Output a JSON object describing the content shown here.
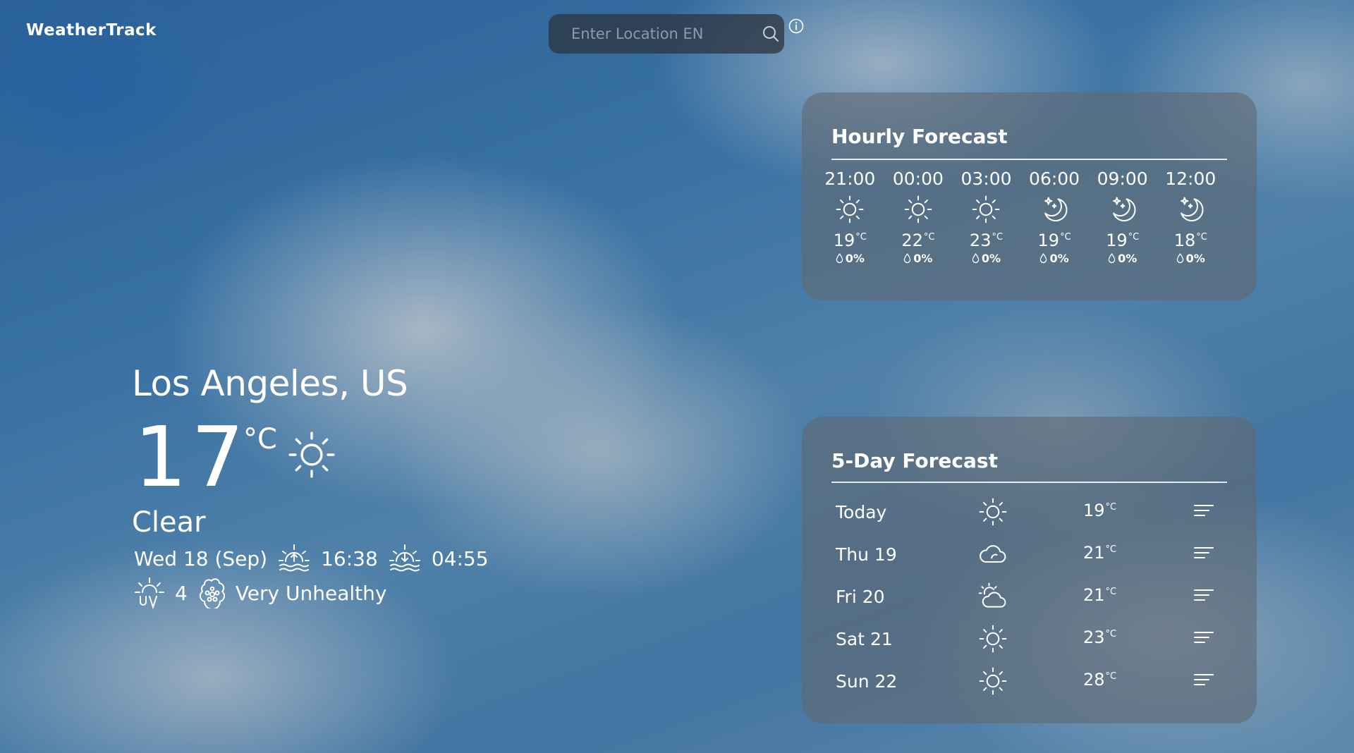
{
  "app": {
    "logo_text": "WeatherTrack"
  },
  "search": {
    "placeholder": "Enter Location EN",
    "value": ""
  },
  "current": {
    "location": "Los Angeles, US",
    "temperature": "17",
    "unit": "°C",
    "condition": "Clear",
    "condition_icon": "sun-icon",
    "date": "Wed 18 (Sep)",
    "sunrise": "16:38",
    "sunset": "04:55",
    "uv_index": "4",
    "air_quality": "Very Unhealthy"
  },
  "hourly": {
    "title": "Hourly Forecast",
    "items": [
      {
        "time": "21:00",
        "icon": "sun-icon",
        "temp": "19",
        "unit": "°C",
        "rain": "0%"
      },
      {
        "time": "00:00",
        "icon": "sun-icon",
        "temp": "22",
        "unit": "°C",
        "rain": "0%"
      },
      {
        "time": "03:00",
        "icon": "sun-icon",
        "temp": "23",
        "unit": "°C",
        "rain": "0%"
      },
      {
        "time": "06:00",
        "icon": "moon-icon",
        "temp": "19",
        "unit": "°C",
        "rain": "0%"
      },
      {
        "time": "09:00",
        "icon": "moon-icon",
        "temp": "19",
        "unit": "°C",
        "rain": "0%"
      },
      {
        "time": "12:00",
        "icon": "moon-icon",
        "temp": "18",
        "unit": "°C",
        "rain": "0%"
      }
    ]
  },
  "daily": {
    "title": "5-Day Forecast",
    "items": [
      {
        "day": "Today",
        "icon": "sun-icon",
        "temp": "19",
        "unit": "°C"
      },
      {
        "day": "Thu 19",
        "icon": "cloud-icon",
        "temp": "21",
        "unit": "°C"
      },
      {
        "day": "Fri 20",
        "icon": "partly-cloudy-icon",
        "temp": "21",
        "unit": "°C"
      },
      {
        "day": "Sat 21",
        "icon": "sun-icon",
        "temp": "23",
        "unit": "°C"
      },
      {
        "day": "Sun 22",
        "icon": "sun-icon",
        "temp": "28",
        "unit": "°C"
      }
    ]
  }
}
